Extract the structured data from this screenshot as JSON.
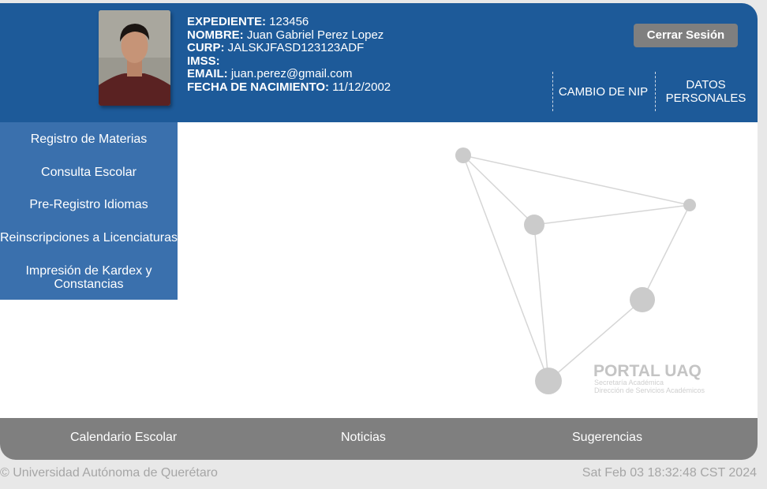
{
  "header": {
    "fields": [
      {
        "label": "EXPEDIENTE:",
        "value": "123456"
      },
      {
        "label": "NOMBRE:",
        "value": "Juan Gabriel Perez Lopez"
      },
      {
        "label": "CURP:",
        "value": "JALSKJFASD123123ADF"
      },
      {
        "label": "IMSS:",
        "value": ""
      },
      {
        "label": "EMAIL:",
        "value": "juan.perez@gmail.com"
      },
      {
        "label": "FECHA DE NACIMIENTO:",
        "value": "11/12/2002"
      }
    ],
    "logout_label": "Cerrar Sesión",
    "change_pin_label": "CAMBIO DE NIP",
    "personal_data_label_line1": "DATOS",
    "personal_data_label_line2": "PERSONALES"
  },
  "sidebar": {
    "items": [
      {
        "label": "Registro de Materias"
      },
      {
        "label": "Consulta Escolar"
      },
      {
        "label": "Pre-Registro Idiomas"
      },
      {
        "label": "Reinscripciones a Licenciaturas"
      },
      {
        "label_line1": "Impresión de Kardex y",
        "label_line2": "Constancias"
      }
    ]
  },
  "logo": {
    "title": "PORTAL UAQ",
    "line1": "Secretaría Académica",
    "line2": "Dirección de Servicios Académicos"
  },
  "footer": {
    "links": [
      {
        "label": "Calendario Escolar"
      },
      {
        "label": "Noticias"
      },
      {
        "label": "Sugerencias"
      }
    ]
  },
  "bottom": {
    "copyright": "© Universidad Autónoma de Querétaro",
    "datetime": "Sat Feb 03 18:32:48 CST 2024"
  },
  "colors": {
    "header_blue": "#1d5a99",
    "sidebar_blue": "#3a70ad",
    "footer_gray": "#7f7f7f"
  }
}
